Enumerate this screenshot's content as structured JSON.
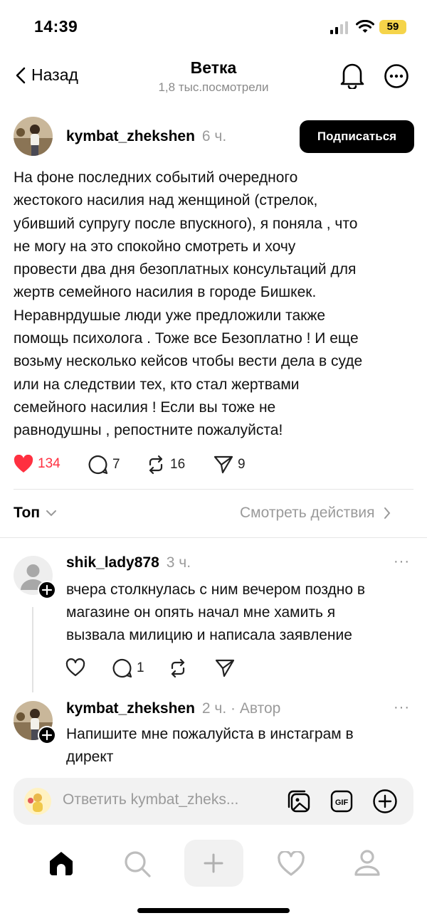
{
  "status_bar": {
    "time": "14:39",
    "battery": "59"
  },
  "header": {
    "back_label": "Назад",
    "title": "Ветка",
    "subtitle": "1,8 тыс.посмотрели"
  },
  "post": {
    "username": "kymbat_zhekshen",
    "time": "6 ч.",
    "subscribe_label": "Подписаться",
    "lines": [
      "На фоне последних событий очередного",
      "жестокого насилия над женщиной (стрелок,",
      "убивший супругу после впускного), я поняла , что",
      "не могу на это спокойно смотреть и хочу",
      "провести два дня безоплатных консультаций для",
      "жертв семейного насилия в городе Бишкек.",
      "Неравнрдушые люди уже предложили также",
      "помощь психолога . Тоже все Безоплатно ! И еще",
      "возьму несколько кейсов чтобы вести дела в суде",
      "или на следствии тех, кто стал жертвами",
      "семейного насилия ! Если вы тоже не",
      "равнодушны , репостните пожалуйста!"
    ],
    "likes": "134",
    "comments": "7",
    "reposts": "16",
    "shares": "9"
  },
  "sort": {
    "label": "Топ",
    "activity_link": "Смотреть действия"
  },
  "replies": [
    {
      "username": "shik_lady878",
      "time": "3 ч.",
      "lines": [
        "вчера столкнулась с ним вечером поздно в",
        "магазине он опять начал мне хамить я",
        "вызвала милицию и написала заявление"
      ],
      "comments": "1"
    },
    {
      "username": "kymbat_zhekshen",
      "time": "2 ч. · Автор",
      "lines": [
        "Напишите мне пожалуйста в инстаграм в",
        "директ"
      ]
    }
  ],
  "reply_bar": {
    "placeholder": "Ответить kymbat_zheks..."
  },
  "colors": {
    "like_red": "#ff3040",
    "battery_yellow": "#f5d44a"
  }
}
